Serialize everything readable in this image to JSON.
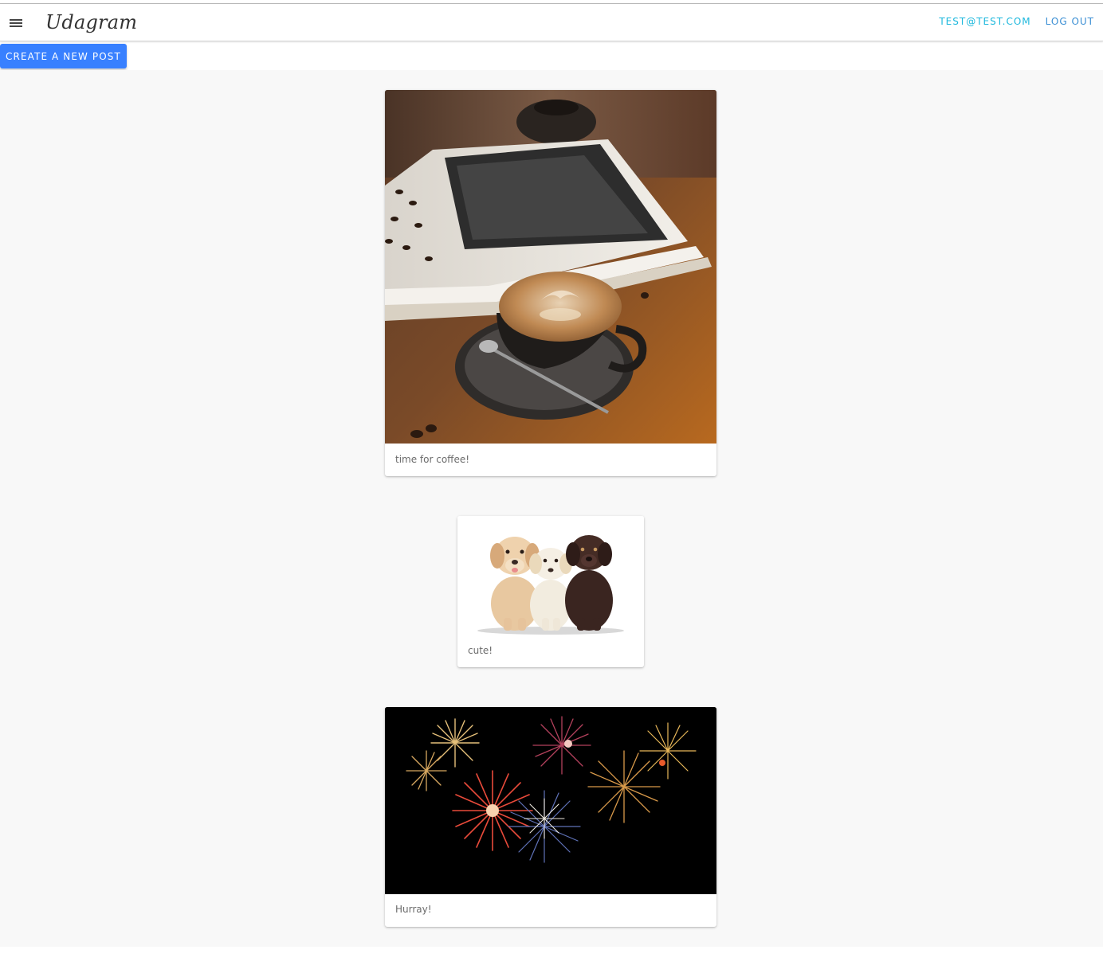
{
  "app": {
    "brand": "Udagram",
    "menu_icon": "menu-icon"
  },
  "nav": {
    "user_email": "TEST@TEST.COM",
    "logout_label": "LOG OUT"
  },
  "actions": {
    "create_post_label": "CREATE A NEW POST"
  },
  "feed": [
    {
      "caption": "time for coffee!",
      "image": "coffee-latte-photo"
    },
    {
      "caption": "cute!",
      "image": "three-puppies-photo"
    },
    {
      "caption": "Hurray!",
      "image": "fireworks-photo"
    }
  ],
  "colors": {
    "primary_button": "#3880ff",
    "email_link": "#1eb8dd",
    "logout_link": "#3b8fd4",
    "page_background": "#f8f8f8"
  }
}
